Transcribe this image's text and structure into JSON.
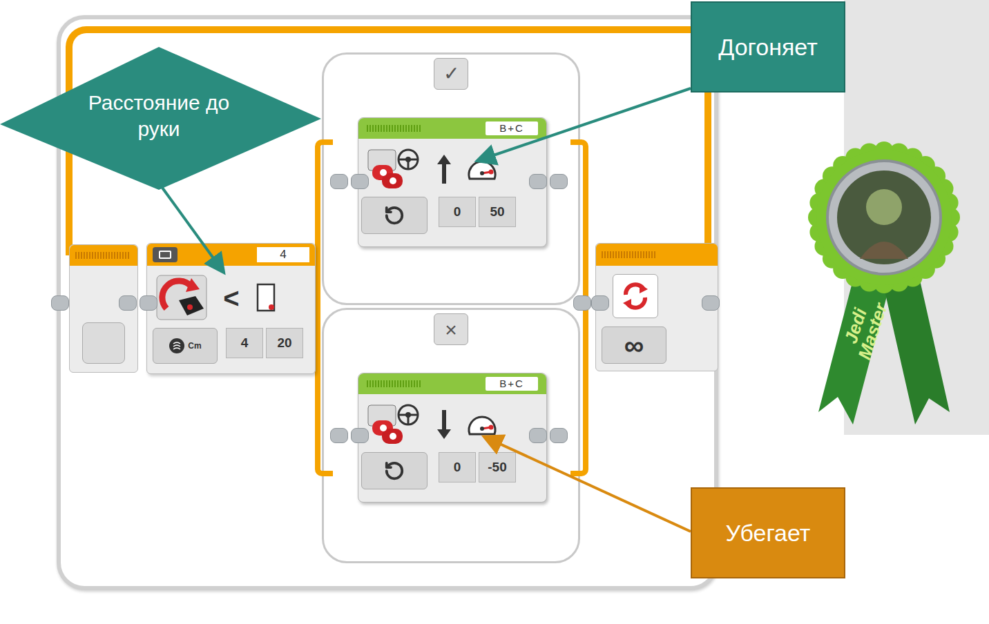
{
  "callouts": [
    {
      "text": "Расстояние до руки",
      "color": "#2a8c7e",
      "kind": "diamond"
    },
    {
      "text": "Догоняет",
      "color": "#2a8c7e",
      "kind": "box"
    },
    {
      "text": "Убегает",
      "color": "#d98a10",
      "kind": "box"
    }
  ],
  "loop": {
    "mode": "∞"
  },
  "switch": {
    "port": "4",
    "operator": "<",
    "unit": "Cm",
    "inputs": [
      "4",
      "20"
    ]
  },
  "cases": [
    {
      "tab": "✓",
      "move": {
        "ports": "B+C",
        "direction": "forward",
        "steering": "0",
        "power": "50"
      }
    },
    {
      "tab": "×",
      "move": {
        "ports": "B+C",
        "direction": "backward",
        "steering": "0",
        "power": "-50"
      }
    }
  ],
  "badge": {
    "text": "Jedi Master"
  }
}
